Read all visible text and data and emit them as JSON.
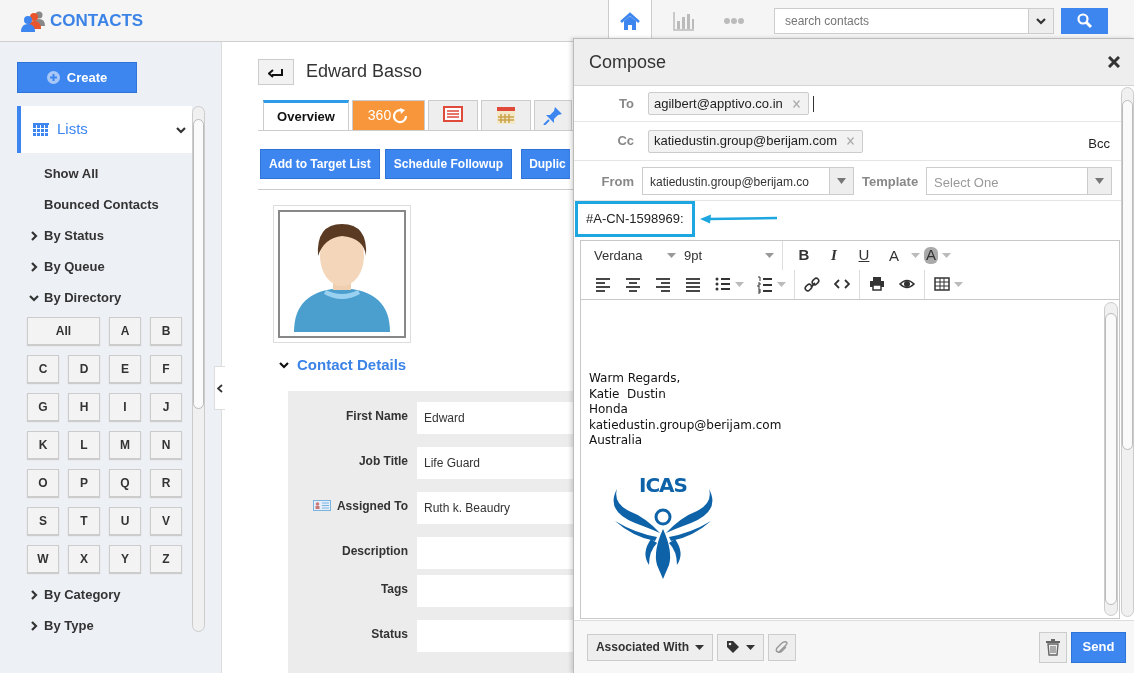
{
  "app": {
    "title": "CONTACTS"
  },
  "top_nav": [
    {
      "selected": true
    },
    {
      "selected": false
    },
    {
      "selected": false
    }
  ],
  "search": {
    "placeholder": "search contacts"
  },
  "sidebar": {
    "create_label": "Create",
    "lists": {
      "label": "Lists",
      "expanded": true
    },
    "items": [
      {
        "kind": "link",
        "label": "Show All"
      },
      {
        "kind": "link",
        "label": "Bounced Contacts"
      },
      {
        "kind": "group",
        "label": "By Status",
        "expanded": false
      },
      {
        "kind": "group",
        "label": "By Queue",
        "expanded": false
      },
      {
        "kind": "group",
        "label": "By Directory",
        "expanded": true,
        "letters": [
          "All",
          "A",
          "B",
          "C",
          "D",
          "E",
          "F",
          "G",
          "H",
          "I",
          "J",
          "K",
          "L",
          "M",
          "N",
          "O",
          "P",
          "Q",
          "R",
          "S",
          "T",
          "U",
          "V",
          "W",
          "X",
          "Y",
          "Z"
        ]
      },
      {
        "kind": "group",
        "label": "By Category",
        "expanded": false
      },
      {
        "kind": "group",
        "label": "By Type",
        "expanded": false
      }
    ]
  },
  "contact": {
    "name": "Edward Basso",
    "tabs": [
      {
        "kind": "text",
        "label": "Overview",
        "selected": true
      },
      {
        "kind": "orange",
        "label": "360",
        "selected": false
      },
      {
        "kind": "list",
        "selected": false
      },
      {
        "kind": "calendar",
        "selected": false
      },
      {
        "kind": "pin",
        "selected": false
      }
    ],
    "actions": [
      "Add to Target List",
      "Schedule Followup",
      "Duplic"
    ],
    "section": {
      "title": "Contact Details",
      "expanded": true
    },
    "fields": [
      {
        "kind": "plain",
        "label": "First Name",
        "value": "Edward"
      },
      {
        "kind": "plain",
        "label": "Job Title",
        "value": "Life Guard"
      },
      {
        "kind": "assignee",
        "label": "Assigned To",
        "value": "Ruth k. Beaudry"
      },
      {
        "kind": "plain",
        "label": "Description"
      },
      {
        "kind": "plain",
        "label": "Tags"
      },
      {
        "kind": "plain",
        "label": "Status"
      }
    ]
  },
  "compose": {
    "title": "Compose",
    "to": {
      "label": "To",
      "recipients": [
        "agilbert@apptivo.co.in"
      ]
    },
    "cc": {
      "label": "Cc",
      "recipients": [
        "katiedustin.group@berijam.com"
      ]
    },
    "bcc_label": "Bcc",
    "from": {
      "label": "From",
      "value": "katiedustin.group@berijam.co"
    },
    "template": {
      "label": "Template",
      "placeholder": "Select One"
    },
    "subject": "#A-CN-1598969:",
    "editor": {
      "font": "Verdana",
      "size": "9pt",
      "format": [
        {
          "kind": "bold",
          "label": "B"
        },
        {
          "kind": "italic",
          "label": "I"
        },
        {
          "kind": "underline",
          "label": "U"
        },
        {
          "kind": "color",
          "label": "A"
        },
        {
          "kind": "highlight",
          "label": "A"
        }
      ]
    },
    "body": [
      "Warm Regards,",
      "Katie  Dustin",
      "Honda",
      "katiedustin.group@berijam.com",
      "Australia"
    ],
    "logo_text": "ICAS",
    "associated_label": "Associated With",
    "send_label": "Send"
  }
}
